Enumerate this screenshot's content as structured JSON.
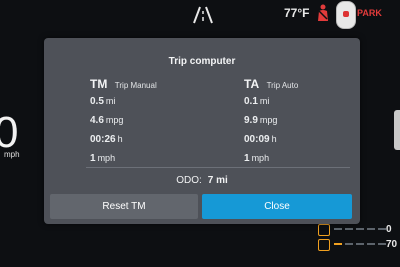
{
  "status_bar": {
    "temperature": "77°F",
    "park_label": "PARK"
  },
  "cluster": {
    "speed": "0",
    "speed_unit": "mph",
    "right_gauge_top": "0",
    "right_gauge_bottom": "70"
  },
  "dialog": {
    "title": "Trip computer",
    "trip_manual": {
      "abbr": "TM",
      "name": "Trip Manual",
      "rows": [
        {
          "value": "0.5",
          "unit": "mi"
        },
        {
          "value": "4.6",
          "unit": "mpg"
        },
        {
          "value": "00:26",
          "unit": "h"
        },
        {
          "value": "1",
          "unit": "mph"
        }
      ]
    },
    "trip_auto": {
      "abbr": "TA",
      "name": "Trip Auto",
      "rows": [
        {
          "value": "0.1",
          "unit": "mi"
        },
        {
          "value": "9.9",
          "unit": "mpg"
        },
        {
          "value": "00:09",
          "unit": "h"
        },
        {
          "value": "1",
          "unit": "mph"
        }
      ]
    },
    "odo_label": "ODO:",
    "odo_value": "7 mi",
    "reset_button": "Reset TM",
    "close_button": "Close"
  },
  "colors": {
    "dialog_bg": "#4e5158",
    "close_button": "#1699d6",
    "reset_button": "#62666d",
    "park_red": "#e23b3b",
    "warning_orange": "#f0a020"
  }
}
